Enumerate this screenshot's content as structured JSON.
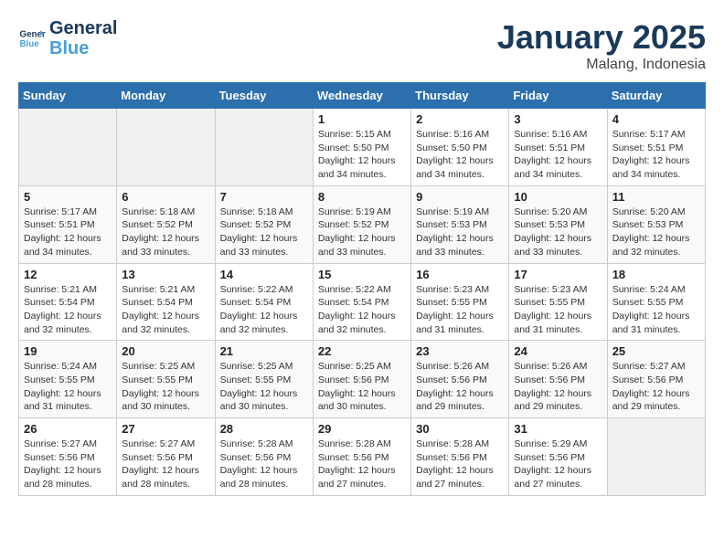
{
  "header": {
    "logo_line1": "General",
    "logo_line2": "Blue",
    "month_title": "January 2025",
    "location": "Malang, Indonesia"
  },
  "weekdays": [
    "Sunday",
    "Monday",
    "Tuesday",
    "Wednesday",
    "Thursday",
    "Friday",
    "Saturday"
  ],
  "weeks": [
    [
      {
        "day": "",
        "info": ""
      },
      {
        "day": "",
        "info": ""
      },
      {
        "day": "",
        "info": ""
      },
      {
        "day": "1",
        "info": "Sunrise: 5:15 AM\nSunset: 5:50 PM\nDaylight: 12 hours\nand 34 minutes."
      },
      {
        "day": "2",
        "info": "Sunrise: 5:16 AM\nSunset: 5:50 PM\nDaylight: 12 hours\nand 34 minutes."
      },
      {
        "day": "3",
        "info": "Sunrise: 5:16 AM\nSunset: 5:51 PM\nDaylight: 12 hours\nand 34 minutes."
      },
      {
        "day": "4",
        "info": "Sunrise: 5:17 AM\nSunset: 5:51 PM\nDaylight: 12 hours\nand 34 minutes."
      }
    ],
    [
      {
        "day": "5",
        "info": "Sunrise: 5:17 AM\nSunset: 5:51 PM\nDaylight: 12 hours\nand 34 minutes."
      },
      {
        "day": "6",
        "info": "Sunrise: 5:18 AM\nSunset: 5:52 PM\nDaylight: 12 hours\nand 33 minutes."
      },
      {
        "day": "7",
        "info": "Sunrise: 5:18 AM\nSunset: 5:52 PM\nDaylight: 12 hours\nand 33 minutes."
      },
      {
        "day": "8",
        "info": "Sunrise: 5:19 AM\nSunset: 5:52 PM\nDaylight: 12 hours\nand 33 minutes."
      },
      {
        "day": "9",
        "info": "Sunrise: 5:19 AM\nSunset: 5:53 PM\nDaylight: 12 hours\nand 33 minutes."
      },
      {
        "day": "10",
        "info": "Sunrise: 5:20 AM\nSunset: 5:53 PM\nDaylight: 12 hours\nand 33 minutes."
      },
      {
        "day": "11",
        "info": "Sunrise: 5:20 AM\nSunset: 5:53 PM\nDaylight: 12 hours\nand 32 minutes."
      }
    ],
    [
      {
        "day": "12",
        "info": "Sunrise: 5:21 AM\nSunset: 5:54 PM\nDaylight: 12 hours\nand 32 minutes."
      },
      {
        "day": "13",
        "info": "Sunrise: 5:21 AM\nSunset: 5:54 PM\nDaylight: 12 hours\nand 32 minutes."
      },
      {
        "day": "14",
        "info": "Sunrise: 5:22 AM\nSunset: 5:54 PM\nDaylight: 12 hours\nand 32 minutes."
      },
      {
        "day": "15",
        "info": "Sunrise: 5:22 AM\nSunset: 5:54 PM\nDaylight: 12 hours\nand 32 minutes."
      },
      {
        "day": "16",
        "info": "Sunrise: 5:23 AM\nSunset: 5:55 PM\nDaylight: 12 hours\nand 31 minutes."
      },
      {
        "day": "17",
        "info": "Sunrise: 5:23 AM\nSunset: 5:55 PM\nDaylight: 12 hours\nand 31 minutes."
      },
      {
        "day": "18",
        "info": "Sunrise: 5:24 AM\nSunset: 5:55 PM\nDaylight: 12 hours\nand 31 minutes."
      }
    ],
    [
      {
        "day": "19",
        "info": "Sunrise: 5:24 AM\nSunset: 5:55 PM\nDaylight: 12 hours\nand 31 minutes."
      },
      {
        "day": "20",
        "info": "Sunrise: 5:25 AM\nSunset: 5:55 PM\nDaylight: 12 hours\nand 30 minutes."
      },
      {
        "day": "21",
        "info": "Sunrise: 5:25 AM\nSunset: 5:55 PM\nDaylight: 12 hours\nand 30 minutes."
      },
      {
        "day": "22",
        "info": "Sunrise: 5:25 AM\nSunset: 5:56 PM\nDaylight: 12 hours\nand 30 minutes."
      },
      {
        "day": "23",
        "info": "Sunrise: 5:26 AM\nSunset: 5:56 PM\nDaylight: 12 hours\nand 29 minutes."
      },
      {
        "day": "24",
        "info": "Sunrise: 5:26 AM\nSunset: 5:56 PM\nDaylight: 12 hours\nand 29 minutes."
      },
      {
        "day": "25",
        "info": "Sunrise: 5:27 AM\nSunset: 5:56 PM\nDaylight: 12 hours\nand 29 minutes."
      }
    ],
    [
      {
        "day": "26",
        "info": "Sunrise: 5:27 AM\nSunset: 5:56 PM\nDaylight: 12 hours\nand 28 minutes."
      },
      {
        "day": "27",
        "info": "Sunrise: 5:27 AM\nSunset: 5:56 PM\nDaylight: 12 hours\nand 28 minutes."
      },
      {
        "day": "28",
        "info": "Sunrise: 5:28 AM\nSunset: 5:56 PM\nDaylight: 12 hours\nand 28 minutes."
      },
      {
        "day": "29",
        "info": "Sunrise: 5:28 AM\nSunset: 5:56 PM\nDaylight: 12 hours\nand 27 minutes."
      },
      {
        "day": "30",
        "info": "Sunrise: 5:28 AM\nSunset: 5:56 PM\nDaylight: 12 hours\nand 27 minutes."
      },
      {
        "day": "31",
        "info": "Sunrise: 5:29 AM\nSunset: 5:56 PM\nDaylight: 12 hours\nand 27 minutes."
      },
      {
        "day": "",
        "info": ""
      }
    ]
  ]
}
